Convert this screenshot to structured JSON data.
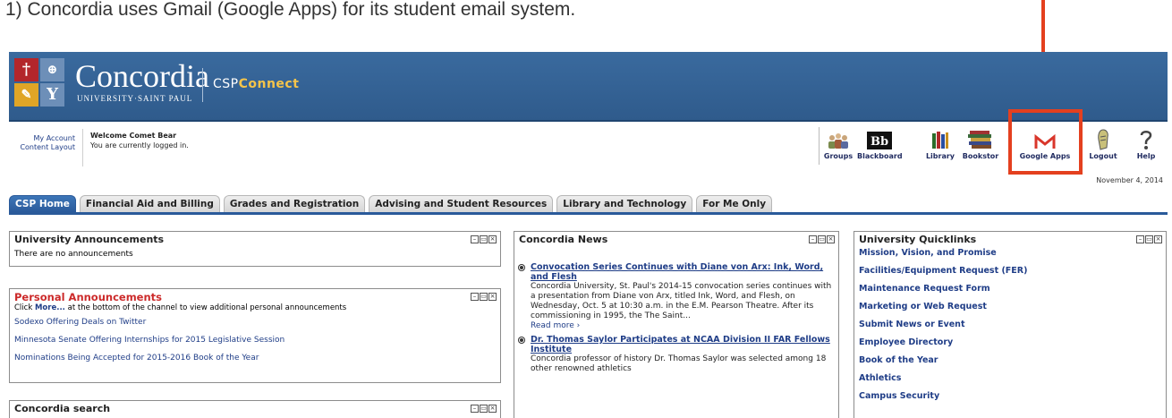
{
  "caption": "1)   Concordia uses Gmail (Google Apps) for its student email system.",
  "brand": {
    "name": "Concordia",
    "subtitle": "UNIVERSITY·SAINT PAUL",
    "app_prefix": "CSP",
    "app_suffix": "Connect"
  },
  "account": {
    "my_account": "My Account",
    "content_layout": "Content Layout",
    "welcome": "Welcome Comet Bear",
    "logged_in": "You are currently logged in."
  },
  "tools": [
    {
      "label": "Groups",
      "icon": "groups-icon"
    },
    {
      "label": "Blackboard",
      "icon": "blackboard-icon"
    },
    {
      "label": "Library",
      "icon": "library-icon"
    },
    {
      "label": "Bookstor",
      "icon": "bookstore-icon"
    },
    {
      "label": "Google Apps",
      "icon": "gmail-icon"
    },
    {
      "label": "Logout",
      "icon": "logout-icon"
    },
    {
      "label": "Help",
      "icon": "help-icon"
    }
  ],
  "date": "November 4, 2014",
  "tabs": [
    "CSP Home",
    "Financial Aid and Billing",
    "Grades and Registration",
    "Advising and Student Resources",
    "Library and Technology",
    "For Me Only"
  ],
  "announcements": {
    "title": "University Announcements",
    "empty": "There are no announcements"
  },
  "personal": {
    "title": "Personal Announcements",
    "hint_prefix": "Click ",
    "hint_more": "More...",
    "hint_suffix": " at the bottom of the channel to view additional personal announcements",
    "links": [
      "Sodexo Offering Deals on Twitter",
      "Minnesota Senate Offering Internships for 2015 Legislative Session",
      "Nominations Being Accepted for 2015-2016 Book of the Year"
    ]
  },
  "search": {
    "title": "Concordia search"
  },
  "news": {
    "title": "Concordia News",
    "items": [
      {
        "title": "Convocation Series Continues with Diane von Arx: Ink, Word, and Flesh",
        "text": "Concordia University, St. Paul's 2014-15 convocation series continues with a presentation from Diane von Arx, titled Ink, Word, and Flesh, on Wednesday, Oct. 5 at 10:30 a.m. in the E.M. Pearson Theatre. After its commissioning in 1995, the The Saint...",
        "more": "Read more ›"
      },
      {
        "title": "Dr. Thomas Saylor Participates at NCAA Division II FAR Fellows Institute",
        "text": "Concordia professor of history Dr. Thomas Saylor was selected among 18 other renowned athletics"
      }
    ]
  },
  "quicklinks": {
    "title": "University Quicklinks",
    "links": [
      "Mission, Vision, and Promise",
      "Facilities/Equipment Request (FER)",
      "Maintenance Request Form",
      "Marketing or Web Request",
      "Submit News or Event",
      "Employee Directory",
      "Book of the Year",
      "Athletics",
      "Campus Security"
    ]
  },
  "colors": {
    "banner": "#2f5b8c",
    "highlight": "#e4401f",
    "link": "#1f3d87",
    "personal_title": "#cc2a2a"
  }
}
